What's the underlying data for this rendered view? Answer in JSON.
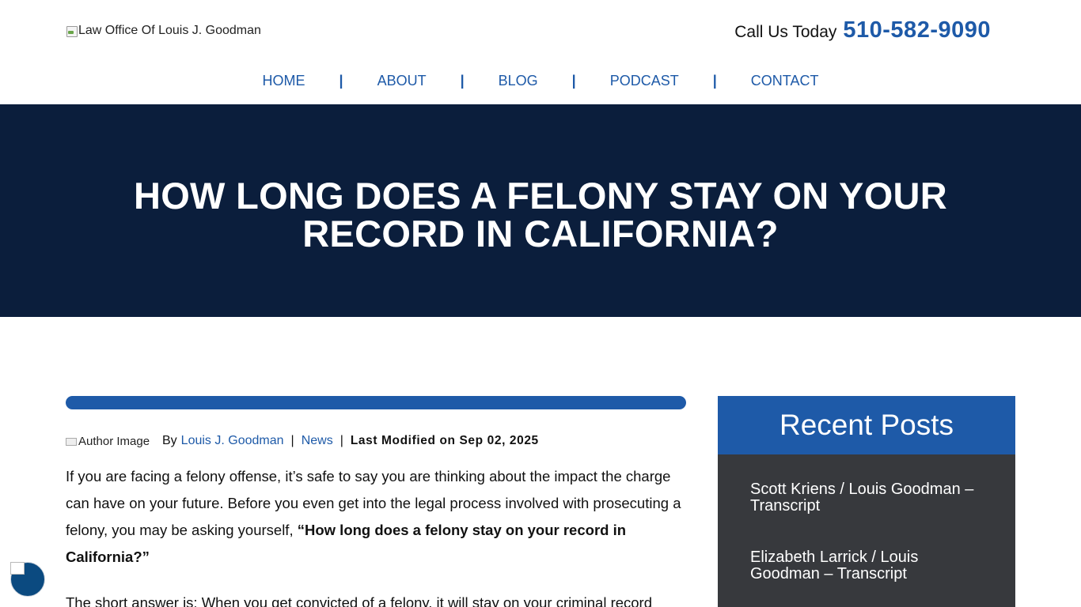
{
  "header": {
    "logo_alt": "Law Office Of Louis J. Goodman",
    "call_label": "Call Us Today",
    "call_number": "510-582-9090"
  },
  "nav": {
    "items": [
      "HOME",
      "ABOUT",
      "BLOG",
      "PODCAST",
      "CONTACT"
    ],
    "separator": "|"
  },
  "hero": {
    "title": "HOW LONG DOES A FELONY STAY ON YOUR RECORD IN CALIFORNIA?"
  },
  "article": {
    "author_image_alt": "Author Image",
    "by": "By",
    "author": "Louis J. Goodman",
    "category": "News",
    "pipe": "|",
    "modified": "Last Modified on Sep 02, 2025",
    "intro_plain": "If you are facing a felony offense, it’s safe to say you are thinking about the impact the charge can have on your future. Before you even get into the legal process involved with prosecuting a felony, you may be asking yourself, ",
    "intro_bold": "“How long does a felony stay on your record in California?”",
    "short_answer": "The short answer is: When you get convicted of a felony, it will stay on your criminal record"
  },
  "sidebar": {
    "title": "Recent Posts",
    "posts": [
      "Scott Kriens / Louis Goodman – Transcript",
      "Elizabeth Larrick / Louis Goodman – Transcript"
    ]
  },
  "colors": {
    "brand_blue": "#1e5aa8",
    "hero_navy": "#0b1e3c",
    "sidebar_dark": "#37393d"
  },
  "icons": {
    "logo": "broken-image-icon",
    "accessibility": "accessibility-icon"
  }
}
